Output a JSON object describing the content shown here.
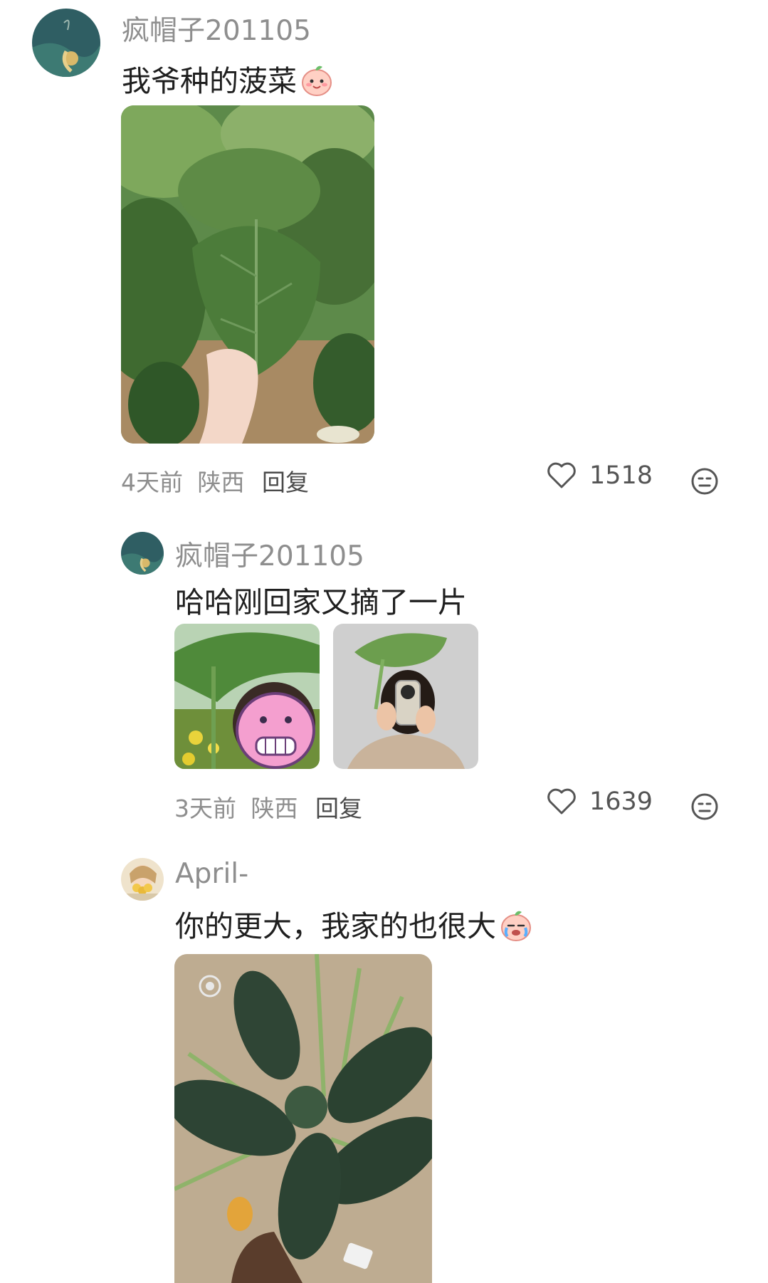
{
  "comments": [
    {
      "username": "疯帽子201105",
      "text": "我爷种的菠菜",
      "time": "4天前",
      "location": "陕西",
      "reply_label": "回复",
      "likes": "1518"
    },
    {
      "username": "疯帽子201105",
      "text": "哈哈刚回家又摘了一片",
      "time": "3天前",
      "location": "陕西",
      "reply_label": "回复",
      "likes": "1639"
    },
    {
      "username": "April-",
      "text": "你的更大，我家的也很大"
    }
  ],
  "icons": {
    "like": "heart-outline-icon",
    "react": "emoji-face-icon",
    "sticker_1": "smiling-peach-emoji",
    "sticker_2": "crying-peach-emoji"
  },
  "colors": {
    "username": "#8e8e8e",
    "text": "#1f1f1f",
    "meta": "#8e8e8e",
    "reply": "#4a4a4a",
    "background": "#ffffff"
  }
}
